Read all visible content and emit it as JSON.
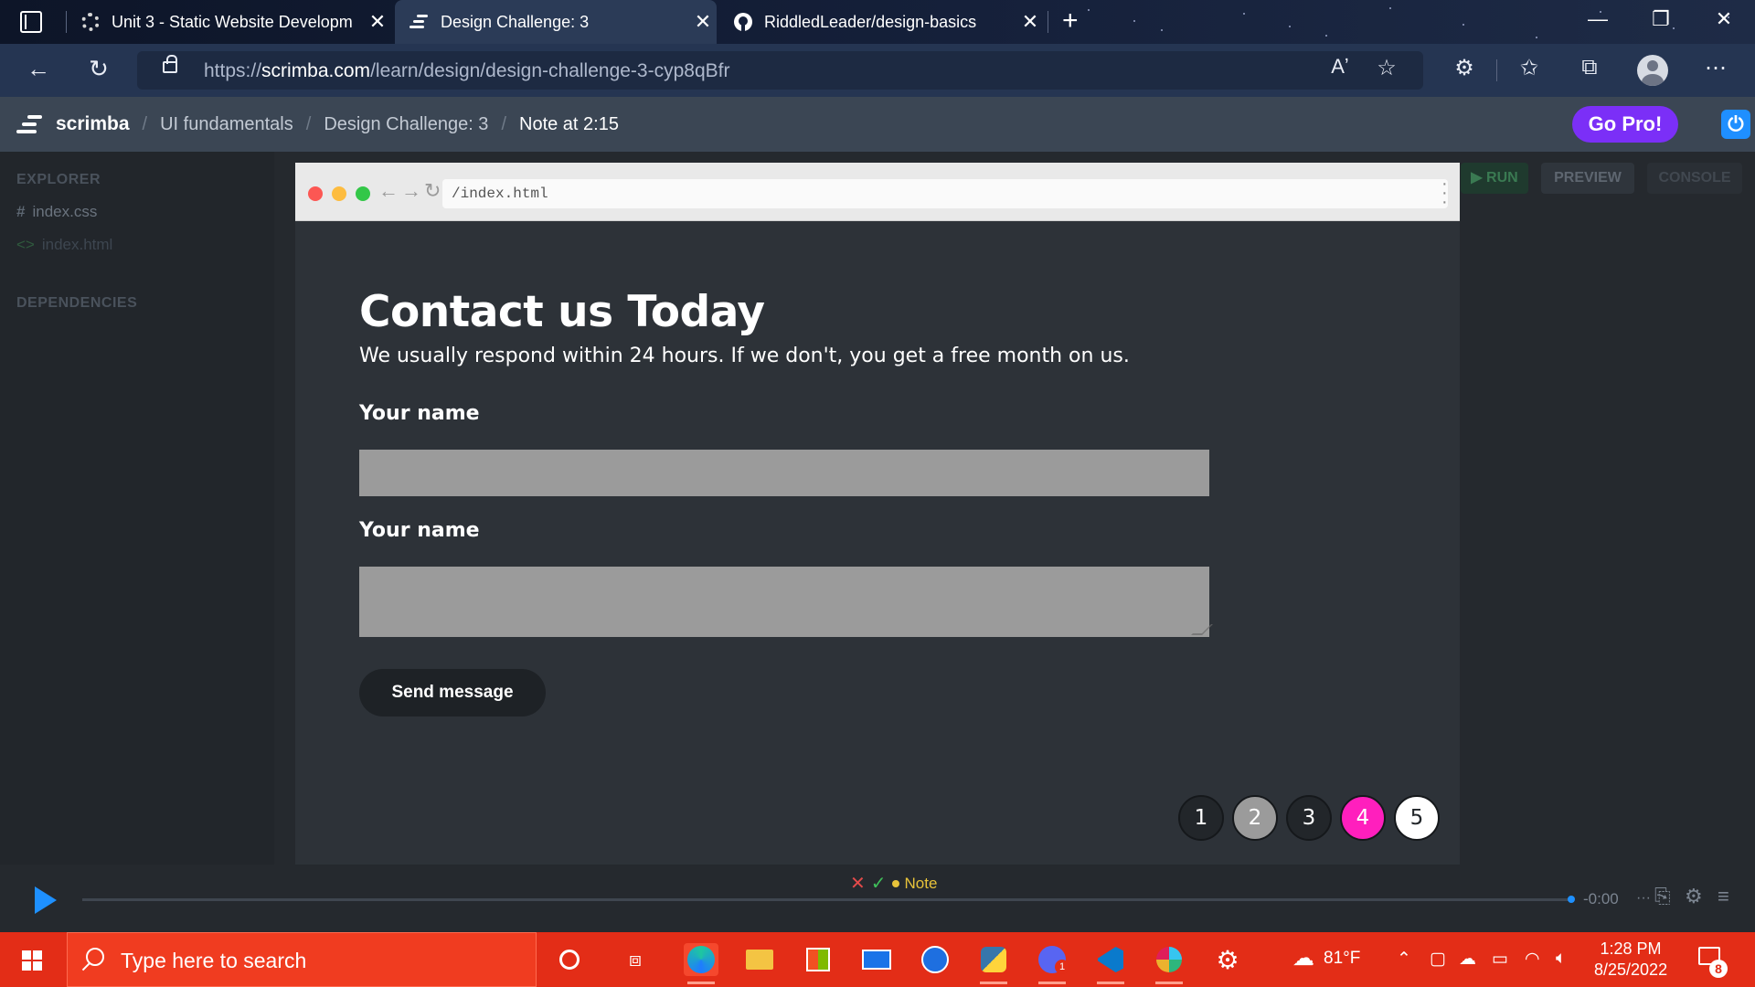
{
  "browser": {
    "tabs": [
      {
        "label": "Unit 3 - Static Website Developm",
        "icon": "gear-icon",
        "active": false
      },
      {
        "label": "Design Challenge: 3",
        "icon": "scrimba-icon",
        "active": true
      },
      {
        "label": "RiddledLeader/design-basics",
        "icon": "github-icon",
        "active": false
      }
    ],
    "url_prefix": "https://",
    "url_host": "scrimba.com",
    "url_path": "/learn/design/design-challenge-3-cyp8qBfr"
  },
  "scrimba": {
    "brand": "scrimba",
    "breadcrumbs": [
      "UI fundamentals",
      "Design Challenge: 3"
    ],
    "current": "Note at 2:15",
    "gopro_label": "Go Pro!",
    "sidebar": {
      "explorer_heading": "EXPLORER",
      "files": [
        "index.css",
        "index.html"
      ],
      "dependencies_heading": "DEPENDENCIES"
    },
    "toolbar": {
      "run": "RUN",
      "preview": "PREVIEW",
      "console": "CONSOLE"
    }
  },
  "preview": {
    "address": "/index.html",
    "heading": "Contact us Today",
    "subheading": "We usually respond within 24 hours. If we don't, you get a free month on us.",
    "field1_label": "Your name",
    "field2_label": "Your name",
    "send_label": "Send message",
    "pages": [
      {
        "label": "1",
        "bg": "#22262a",
        "fg": "#ffffff"
      },
      {
        "label": "2",
        "bg": "#9b9b9b",
        "fg": "#ffffff"
      },
      {
        "label": "3",
        "bg": "#22262a",
        "fg": "#ffffff"
      },
      {
        "label": "4",
        "bg": "#ff1fbd",
        "fg": "#ffffff"
      },
      {
        "label": "5",
        "bg": "#ffffff",
        "fg": "#22262a"
      }
    ]
  },
  "player": {
    "note_label": "Note",
    "time": "-0:00"
  },
  "taskbar": {
    "search_placeholder": "Type here to search",
    "weather": "81°F",
    "time": "1:28 PM",
    "date": "8/25/2022",
    "notifications": "8",
    "chat_badge": "1"
  },
  "colors": {
    "accent_blue": "#1e90ff",
    "gopro_purple": "#7b2ff7",
    "taskbar_red": "#e32d17",
    "pagination_pink": "#ff1fbd"
  }
}
